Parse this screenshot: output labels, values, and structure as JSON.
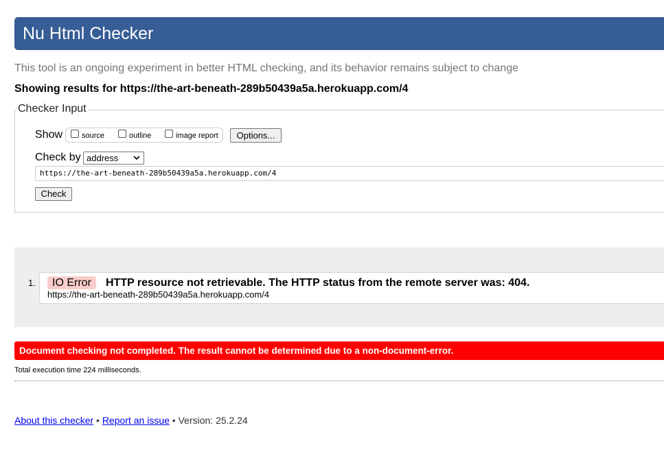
{
  "header": {
    "title": "Nu Html Checker"
  },
  "subtitle": "This tool is an ongoing experiment in better HTML checking, and its behavior remains subject to change",
  "showing_results": "Showing results for https://the-art-beneath-289b50439a5a.herokuapp.com/4",
  "checker_input": {
    "legend": "Checker Input",
    "show_label": "Show",
    "options": [
      {
        "label": "source",
        "checked": false
      },
      {
        "label": "outline",
        "checked": false
      },
      {
        "label": "image report",
        "checked": false
      }
    ],
    "options_button": "Options...",
    "check_by_label": "Check by",
    "check_by_value": "address",
    "url_value": "https://the-art-beneath-289b50439a5a.herokuapp.com/4",
    "check_button": "Check"
  },
  "results": [
    {
      "number": "1.",
      "type": "IO Error",
      "message": "HTTP resource not retrievable. The HTTP status from the remote server was: 404.",
      "url": "https://the-art-beneath-289b50439a5a.herokuapp.com/4"
    }
  ],
  "error_banner": "Document checking not completed. The result cannot be determined due to a non-document-error.",
  "execution_time": "Total execution time 224 milliseconds.",
  "footer": {
    "about_link": "About this checker",
    "separator": " • ",
    "report_link": "Report an issue",
    "version": " • Version: 25.2.24"
  },
  "colors": {
    "header_bg": "#365d95",
    "error_bg": "#ff0000",
    "io_badge_bg": "#f9cdc9",
    "results_bg": "#eeeeee"
  }
}
